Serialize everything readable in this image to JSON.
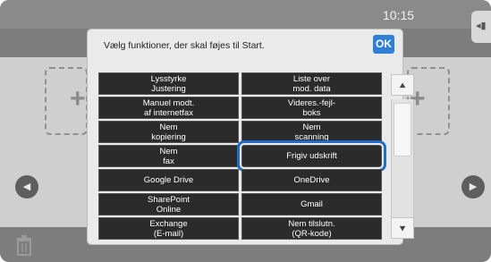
{
  "status": {
    "time": "10:15"
  },
  "dialog": {
    "title": "Vælg funktioner, der skal føjes til Start.",
    "ok_label": "OK"
  },
  "functions": [
    {
      "label": "Lysstyrke\nJustering"
    },
    {
      "label": "Liste over\nmod. data"
    },
    {
      "label": "Manuel modt.\naf internetfax"
    },
    {
      "label": "Videres.-fejl-\nboks"
    },
    {
      "label": "Nem\nkopiering"
    },
    {
      "label": "Nem\nscanning"
    },
    {
      "label": "Nem\nfax"
    },
    {
      "label": "Frigiv udskrift",
      "selected": true
    },
    {
      "label": "Google Drive"
    },
    {
      "label": "OneDrive"
    },
    {
      "label": "SharePoint\nOnline"
    },
    {
      "label": "Gmail"
    },
    {
      "label": "Exchange\n(E-mail)"
    },
    {
      "label": "Nem tilslutn.\n(QR-kode)"
    }
  ],
  "icons": {
    "scroll_up": "chevron-up-icon",
    "scroll_down": "chevron-down-icon",
    "nav_left": "arrow-left-icon",
    "nav_right": "arrow-right-icon",
    "trash": "trash-icon"
  },
  "colors": {
    "accent": "#1f6fc9",
    "button_bg": "#2b2b2b",
    "dialog_bg": "#eaeaea"
  }
}
